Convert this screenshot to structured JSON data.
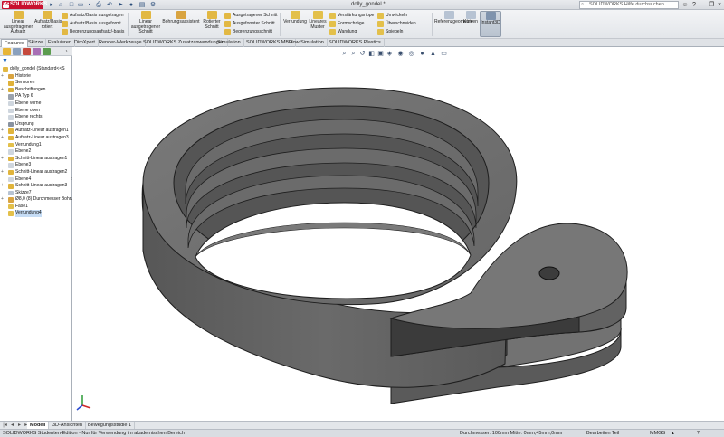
{
  "app": {
    "logo_text": "SOLIDWORKS",
    "document_title": "dolly_gondel *",
    "help_search_placeholder": "SOLIDWORKS Hilfe durchsuchen"
  },
  "commands": {
    "linear_boss_extrude": "Linear ausgetragener Aufsatz",
    "revolve_boss": "Aufsatz/Basis rotiert",
    "sweep_boss": "Aufsatz/Basis ausgetragen",
    "loft_boss": "Aufsatz/Basis ausgeformt",
    "boundary_boss": "Begrenzungsaufsatz/-basis",
    "linear_cut": "Linear ausgetragener Schnitt",
    "hole_wizard": "Bohrungsassistent",
    "revolve_cut": "Rotierter Schnitt",
    "sweep_cut": "Ausgetragener Schnitt",
    "loft_cut": "Ausgeformter Schnitt",
    "boundary_cut": "Begrenzungsschnitt",
    "fillet": "Verrundung",
    "linear_pattern": "Lineares Muster",
    "rib": "Verstärkungsrippe",
    "draft": "Formschräge",
    "shell": "Wandung",
    "wrap": "Umwickeln",
    "intersect": "Überschneiden",
    "mirror": "Spiegeln",
    "reference_geometry": "Referenzgeometrie",
    "curves": "Kurven",
    "instant3d": "Instant3D"
  },
  "tabs": [
    "Features",
    "Skizze",
    "Evaluieren",
    "DimXpert",
    "Render-Werkzeuge",
    "SOLIDWORKS Zusatzanwendungen",
    "Simulation",
    "SOLIDWORKS MBD",
    "Flow Simulation",
    "SOLIDWORKS Plastics"
  ],
  "tree": {
    "root": "dolly_gondel  (Standard<<S",
    "items": [
      {
        "label": "Historie",
        "icon": "history-icon",
        "color": "#d9a441",
        "expand": "+"
      },
      {
        "label": "Sensoren",
        "icon": "sensor-icon",
        "color": "#e0b23a",
        "expand": ""
      },
      {
        "label": "Beschriftungen",
        "icon": "annotation-icon",
        "color": "#d8b03c",
        "expand": "+"
      },
      {
        "label": "PA Typ 6",
        "icon": "material-icon",
        "color": "#9aa2ad",
        "expand": ""
      },
      {
        "label": "Ebene vorne",
        "icon": "plane-icon",
        "color": "#cfd6de",
        "expand": ""
      },
      {
        "label": "Ebene oben",
        "icon": "plane-icon",
        "color": "#cfd6de",
        "expand": ""
      },
      {
        "label": "Ebene rechts",
        "icon": "plane-icon",
        "color": "#cfd6de",
        "expand": ""
      },
      {
        "label": "Ursprung",
        "icon": "origin-icon",
        "color": "#8892a0",
        "expand": ""
      },
      {
        "label": "Aufsatz-Linear austragen1",
        "icon": "extrude-icon",
        "color": "#e0b43c",
        "expand": "+"
      },
      {
        "label": "Aufsatz-Linear austragen3",
        "icon": "extrude-icon",
        "color": "#e0b43c",
        "expand": "+"
      },
      {
        "label": "Verrundung1",
        "icon": "fillet-icon",
        "color": "#e3c04b",
        "expand": ""
      },
      {
        "label": "Ebene2",
        "icon": "plane-icon",
        "color": "#cfd6de",
        "expand": ""
      },
      {
        "label": "Schnitt-Linear austragen1",
        "icon": "cut-icon",
        "color": "#e0b43c",
        "expand": "+"
      },
      {
        "label": "Ebene3",
        "icon": "plane-icon",
        "color": "#cfd6de",
        "expand": ""
      },
      {
        "label": "Schnitt-Linear austragen2",
        "icon": "cut-icon",
        "color": "#e0b43c",
        "expand": "+"
      },
      {
        "label": "Ebene4",
        "icon": "plane-icon",
        "color": "#cfd6de",
        "expand": ""
      },
      {
        "label": "Schnitt-Linear austragen3",
        "icon": "cut-icon",
        "color": "#e0b43c",
        "expand": "+"
      },
      {
        "label": "Skizze7",
        "icon": "sketch-icon",
        "color": "#b7c3d3",
        "expand": ""
      },
      {
        "label": "Ø8,0 (8) Durchmesser Bohru",
        "icon": "hole-icon",
        "color": "#d9a441",
        "expand": "+"
      },
      {
        "label": "Fase1",
        "icon": "chamfer-icon",
        "color": "#e3c04b",
        "expand": ""
      },
      {
        "label": "Verrundung4",
        "icon": "fillet-icon",
        "color": "#e3c04b",
        "expand": ""
      }
    ]
  },
  "bottom_tabs": [
    "Modell",
    "3D-Ansichten",
    "Bewegungsstudie 1"
  ],
  "status": {
    "edition": "SOLIDWORKS Studenten-Edition - Nur für Verwendung im akademischen Bereich",
    "measure": "Durchmesser: 100mm  Mitte: 0mm,45mm,0mm",
    "edit_mode": "Bearbeiten Teil",
    "units": "MMGS"
  },
  "colors": {
    "model_top": "#6f6f6f",
    "model_side": "#5d5d5d",
    "model_outline": "#1e1e1e",
    "tab_active": "#ffffff",
    "selection": "#c5dcf5",
    "brand": "#c8102e"
  }
}
